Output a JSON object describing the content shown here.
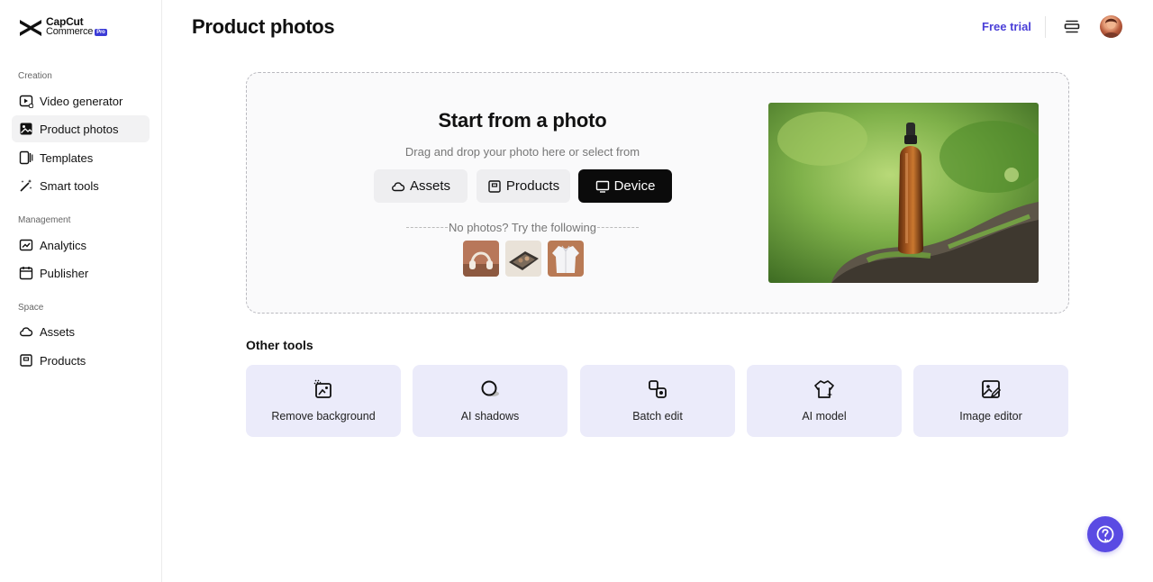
{
  "brand": {
    "line1": "CapCut",
    "line2": "Commerce",
    "badge": "Pro",
    "accent": "#4a3fd8"
  },
  "header": {
    "title": "Product photos",
    "free_trial": "Free trial"
  },
  "sidebar": {
    "sections": [
      {
        "label": "Creation",
        "items": [
          {
            "label": "Video generator",
            "icon": "video-add-icon"
          },
          {
            "label": "Product photos",
            "icon": "image-icon",
            "active": true
          },
          {
            "label": "Templates",
            "icon": "templates-icon"
          },
          {
            "label": "Smart tools",
            "icon": "magic-wand-icon"
          }
        ]
      },
      {
        "label": "Management",
        "items": [
          {
            "label": "Analytics",
            "icon": "chart-icon"
          },
          {
            "label": "Publisher",
            "icon": "calendar-icon"
          }
        ]
      },
      {
        "label": "Space",
        "items": [
          {
            "label": "Assets",
            "icon": "cloud-icon"
          },
          {
            "label": "Products",
            "icon": "box-icon"
          }
        ]
      }
    ]
  },
  "upload": {
    "title": "Start from a photo",
    "subtitle": "Drag and drop your photo here or select from",
    "buttons": [
      {
        "label": "Assets",
        "icon": "cloud-icon"
      },
      {
        "label": "Products",
        "icon": "box-icon"
      },
      {
        "label": "Device",
        "icon": "monitor-icon"
      }
    ],
    "no_photos": "No photos? Try the following"
  },
  "other_tools": {
    "title": "Other tools",
    "items": [
      {
        "label": "Remove background",
        "icon": "remove-background-icon"
      },
      {
        "label": "AI shadows",
        "icon": "shadow-icon"
      },
      {
        "label": "Batch edit",
        "icon": "batch-edit-icon"
      },
      {
        "label": "AI model",
        "icon": "ai-model-icon"
      },
      {
        "label": "Image editor",
        "icon": "image-edit-icon"
      }
    ]
  }
}
